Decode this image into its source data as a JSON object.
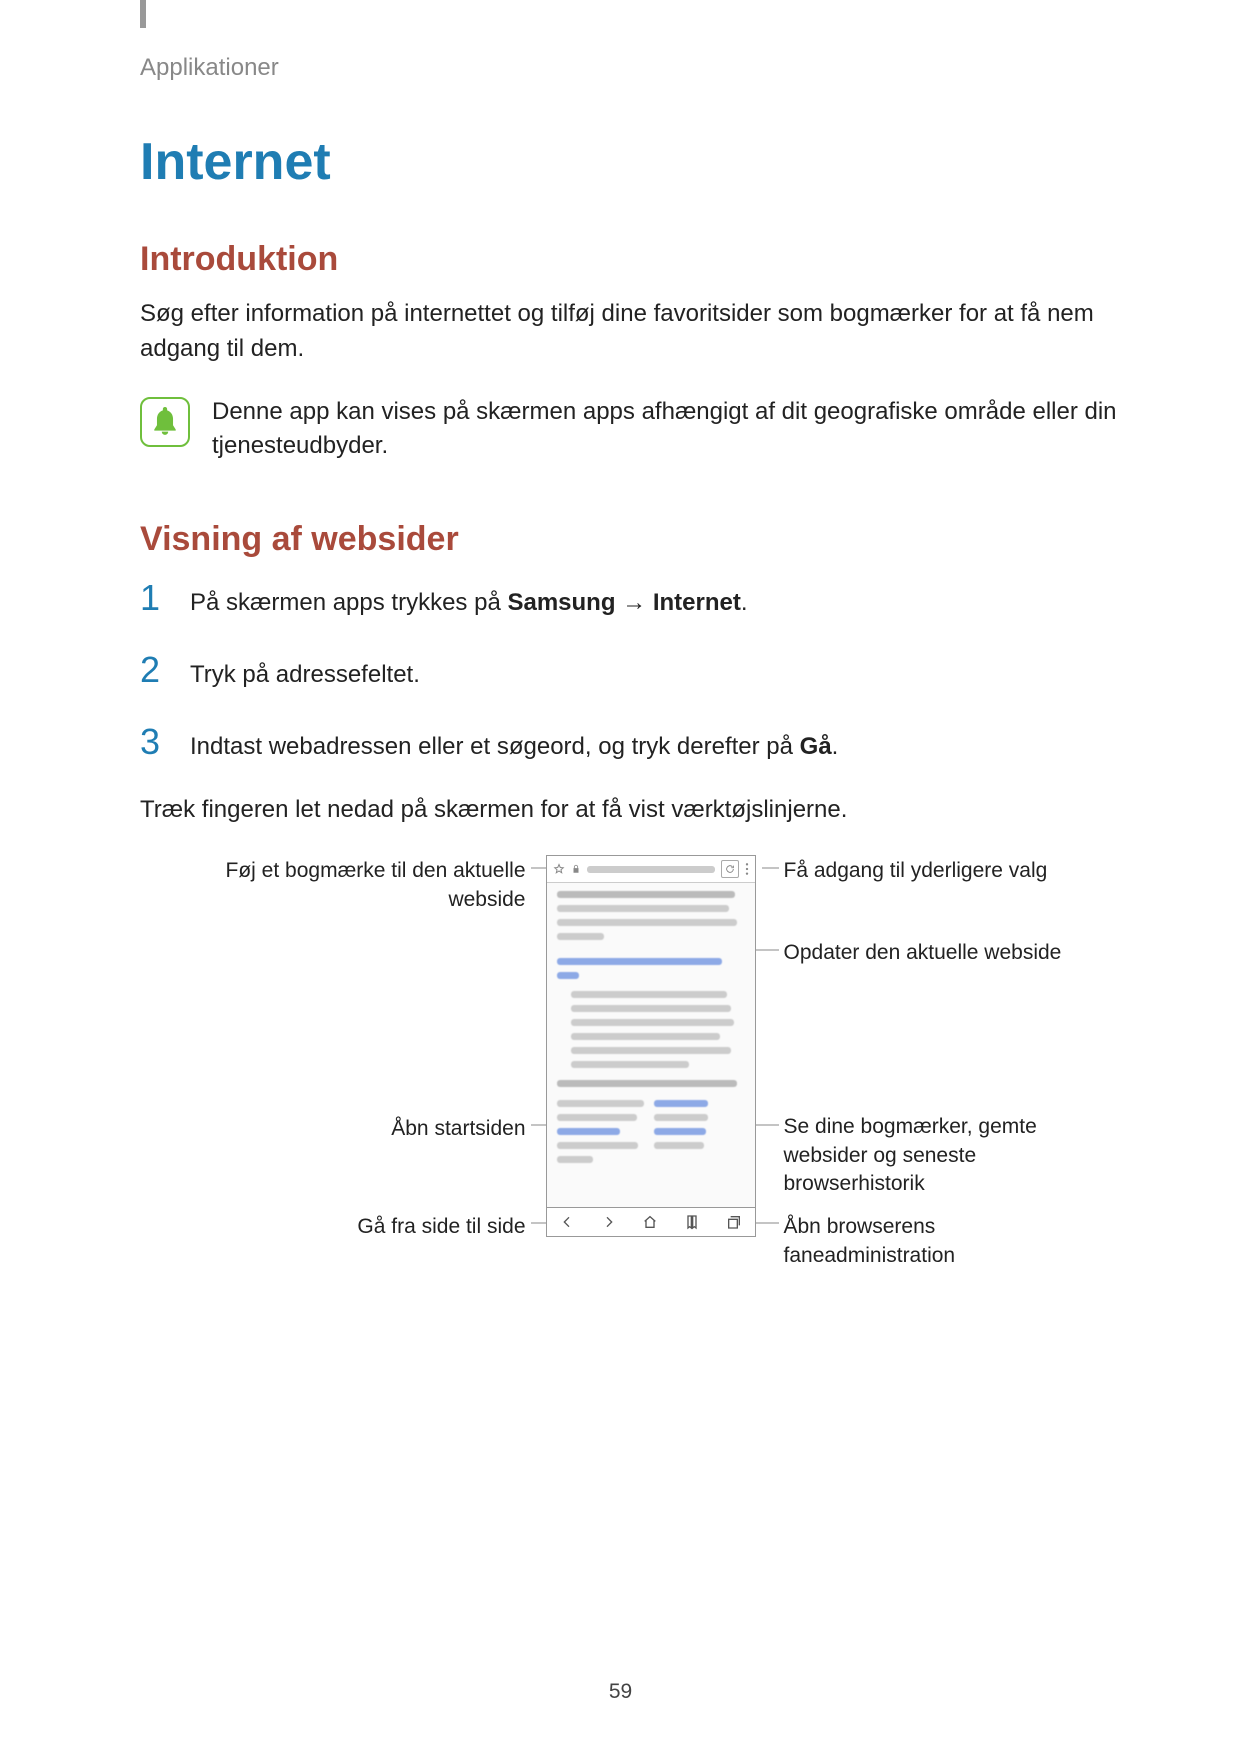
{
  "breadcrumb": "Applikationer",
  "title": "Internet",
  "intro_heading": "Introduktion",
  "intro_text": "Søg efter information på internettet og tilføj dine favoritsider som bogmærker for at få nem adgang til dem.",
  "note_text": "Denne app kan vises på skærmen apps afhængigt af dit geografiske område eller din tjenesteudbyder.",
  "view_heading": "Visning af websider",
  "steps": {
    "s1a": "På skærmen apps trykkes på ",
    "s1b": "Samsung",
    "s1c": " → ",
    "s1d": "Internet",
    "s1e": ".",
    "s2": "Tryk på adressefeltet.",
    "s3a": "Indtast webadressen eller et søgeord, og tryk derefter på ",
    "s3b": "Gå",
    "s3c": "."
  },
  "swipe_text": "Træk fingeren let nedad på skærmen for at få vist værktøjslinjerne.",
  "callouts": {
    "bookmark": "Føj et bogmærke til den aktuelle webside",
    "more": "Få adgang til yderligere valg",
    "reload": "Opdater den aktuelle webside",
    "home": "Åbn startsiden",
    "bookmarks_history": "Se dine bogmærker, gemte websider og seneste browserhistorik",
    "nav": "Gå fra side til side",
    "tabs": "Åbn browserens faneadministration"
  },
  "num": {
    "n1": "1",
    "n2": "2",
    "n3": "3"
  },
  "page_number": "59"
}
